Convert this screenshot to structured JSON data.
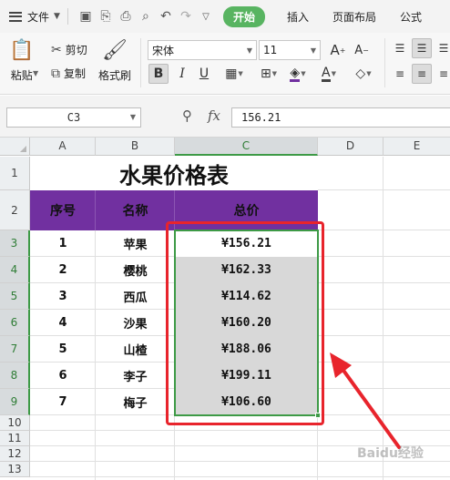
{
  "menubar": {
    "file_label": "文件",
    "tabs": [
      {
        "label": "开始",
        "active": true
      },
      {
        "label": "插入",
        "active": false
      },
      {
        "label": "页面布局",
        "active": false
      },
      {
        "label": "公式",
        "active": false
      }
    ],
    "accent_color": "#58b461"
  },
  "ribbon": {
    "paste_label": "粘贴",
    "cut_label": "剪切",
    "copy_label": "复制",
    "format_painter_label": "格式刷",
    "font_name": "宋体",
    "font_size": "11",
    "bold_glyph": "B",
    "italic_glyph": "I",
    "underline_glyph": "U"
  },
  "formula_bar": {
    "cell_ref": "C3",
    "fx_label": "fx",
    "value": "156.21"
  },
  "sheet": {
    "columns": [
      "A",
      "B",
      "C",
      "D",
      "E"
    ],
    "selected_column": "C",
    "rows": [
      "1",
      "2",
      "3",
      "4",
      "5",
      "6",
      "7",
      "8",
      "9",
      "10",
      "11",
      "12",
      "13"
    ],
    "selected_rows": [
      "3",
      "4",
      "5",
      "6",
      "7",
      "8",
      "9"
    ],
    "title": "水果价格表",
    "headers": {
      "a": "序号",
      "b": "名称",
      "c": "总价"
    },
    "header_fill": "#7130a0",
    "selection_color": "#3d9a46",
    "highlight_color": "#e8242c",
    "data": [
      {
        "no": "1",
        "name": "苹果",
        "price": "¥156.21"
      },
      {
        "no": "2",
        "name": "樱桃",
        "price": "¥162.33"
      },
      {
        "no": "3",
        "name": "西瓜",
        "price": "¥114.62"
      },
      {
        "no": "4",
        "name": "沙果",
        "price": "¥160.20"
      },
      {
        "no": "5",
        "name": "山楂",
        "price": "¥188.06"
      },
      {
        "no": "6",
        "name": "李子",
        "price": "¥199.11"
      },
      {
        "no": "7",
        "name": "梅子",
        "price": "¥106.60"
      }
    ]
  },
  "watermark": "Baidu经验"
}
